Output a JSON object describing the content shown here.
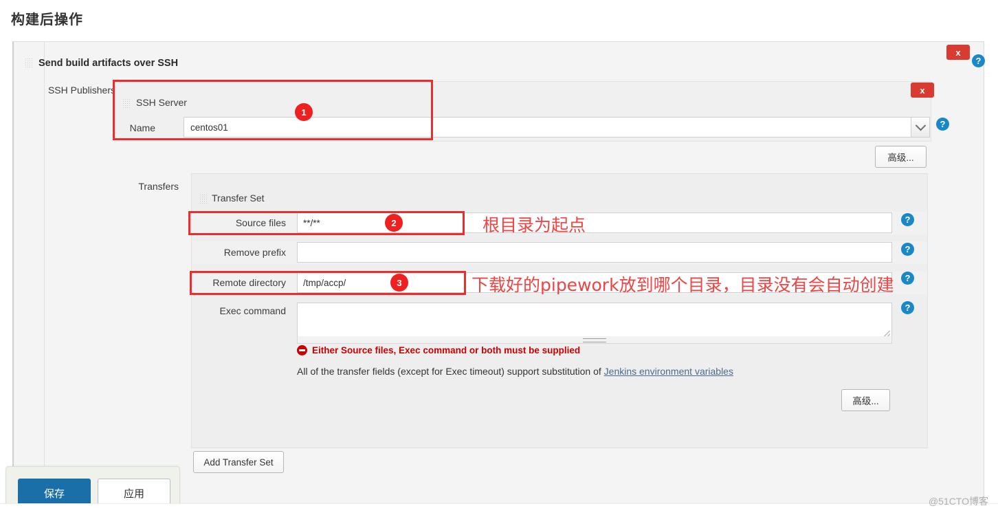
{
  "page": {
    "title": "构建后操作",
    "watermark": "@51CTO博客"
  },
  "panel": {
    "section_title": "Send build artifacts over SSH",
    "close_label": "x",
    "help_label": "?"
  },
  "ssh_publishers": {
    "label": "SSH Publishers",
    "close_label": "x",
    "server_block_title": "SSH Server",
    "name_label": "Name",
    "name_value": "centos01",
    "name_help_label": "?",
    "advanced_label": "高级..."
  },
  "transfers": {
    "label": "Transfers",
    "transfer_set_title": "Transfer Set",
    "fields": [
      {
        "label": "Source files",
        "value": "**/**",
        "placeholder": "",
        "help_label": "?"
      },
      {
        "label": "Remove prefix",
        "value": "",
        "placeholder": "",
        "help_label": "?"
      },
      {
        "label": "Remote directory",
        "value": "/tmp/accp/",
        "placeholder": "",
        "help_label": "?"
      },
      {
        "label": "Exec command",
        "value": "",
        "placeholder": "",
        "help_label": "?"
      }
    ],
    "error_message": "Either Source files, Exec command or both must be supplied",
    "hint_prefix": "All of the transfer fields (except for Exec timeout) support substitution of ",
    "hint_link": "Jenkins environment variables",
    "advanced_label": "高级...",
    "add_transfer_set_label": "Add Transfer Set"
  },
  "footer": {
    "save_label": "保存",
    "apply_label": "应用"
  },
  "annotations": {
    "badge_1": "1",
    "badge_2": "2",
    "badge_3": "3",
    "note_source_files": "根目录为起点",
    "note_remote_directory": "下载好的pipework放到哪个目录，目录没有会自动创建"
  },
  "colors": {
    "annotation_red": "#ef2b2b",
    "annotation_text_red": "#f24343",
    "error_red": "#cc0000",
    "help_blue": "#1a87c8",
    "close_red": "#d93b30",
    "save_blue": "#1a6fa8",
    "link_blue": "#4a6b8a"
  }
}
